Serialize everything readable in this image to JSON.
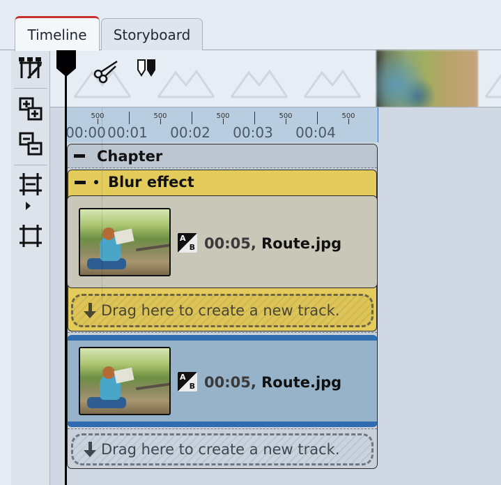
{
  "tabs": [
    {
      "label": "Timeline",
      "active": true
    },
    {
      "label": "Storyboard",
      "active": false
    }
  ],
  "toolbar": {
    "icons": [
      "timeline-split-icon",
      "add-track-icon",
      "remove-track-icon",
      "fit-width-icon",
      "expand-icon"
    ]
  },
  "ruler": {
    "major_labels": [
      "00:00",
      "00:01",
      "00:02",
      "00:03",
      "00:04"
    ],
    "minor_label": "500"
  },
  "chapter": {
    "title": "Chapter"
  },
  "effect": {
    "title": "Blur effect",
    "color": "#e3cc5c"
  },
  "clips": [
    {
      "duration": "00:05,",
      "name": "Route.jpg"
    },
    {
      "duration": "00:05,",
      "name": "Route.jpg"
    }
  ],
  "dropzone": {
    "label": "Drag here to create a new track."
  },
  "colors": {
    "accent_tab": "#c8322c",
    "selected_clip": "#96b3ca",
    "selected_border": "#2f6cb0"
  }
}
